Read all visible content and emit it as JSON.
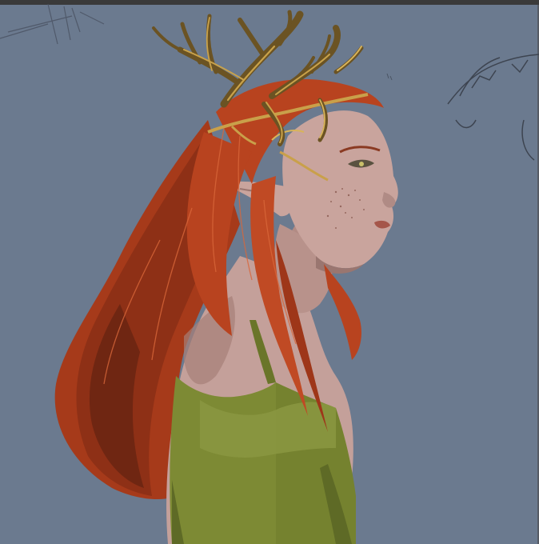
{
  "canvas": {
    "background_color": "#6b7a8f",
    "frame_color": "#3a3a3a"
  },
  "artwork": {
    "subject": "elf-portrait",
    "palette": {
      "hair": "#b8431f",
      "hair_shadow": "#7a2a14",
      "hair_highlight": "#d9673a",
      "skin": "#c7a39a",
      "skin_shadow": "#9a7670",
      "antler": "#6b5323",
      "antler_highlight": "#c9a24a",
      "circlet": "#c9a04a",
      "garment": "#7d8a34",
      "garment_dark": "#5e6a26",
      "sketch_line": "#3d4450"
    }
  }
}
